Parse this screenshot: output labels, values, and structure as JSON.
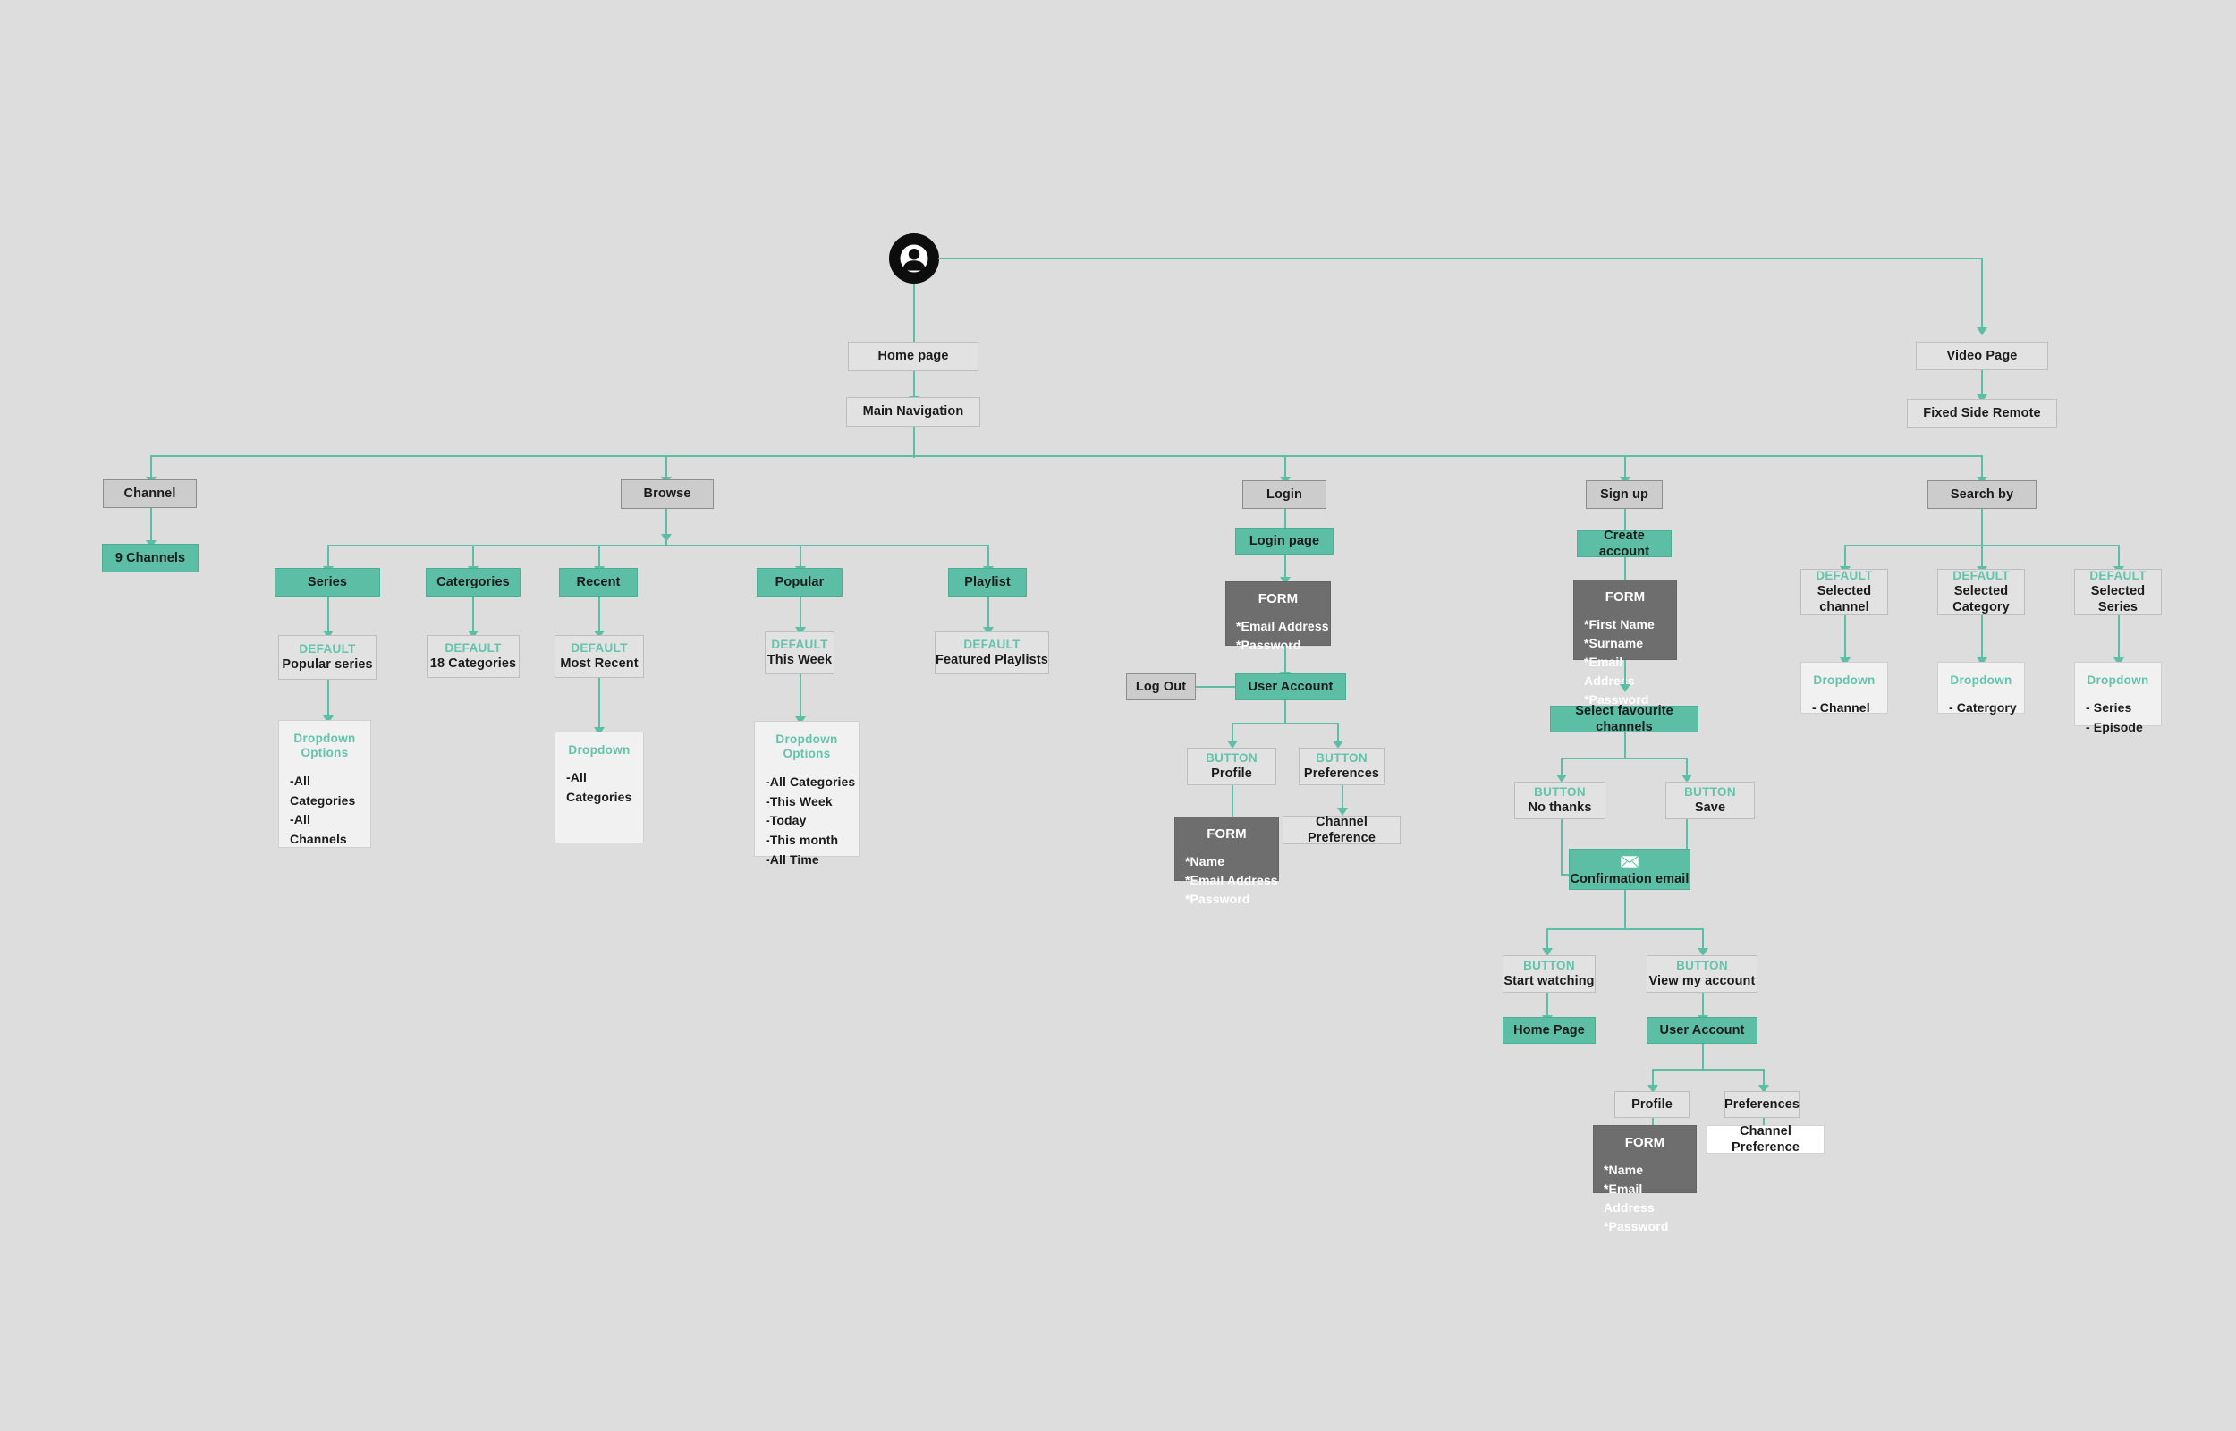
{
  "colors": {
    "background": "#dddddd",
    "accent_teal": "#5cbfa5",
    "page_box": "#cccccc",
    "form_box": "#6e6e6e",
    "dropdown_panel": "#f1f1f1",
    "kicker_text": "#63c4ab"
  },
  "root": {
    "avatar_icon": "user-avatar-icon"
  },
  "labels": {
    "kicker_default": "DEFAULT",
    "kicker_button": "BUTTON",
    "kicker_dropdown": "Dropdown",
    "kicker_dropdown_options_l1": "Dropdown",
    "kicker_dropdown_options_l2": "Options",
    "form_title": "FORM"
  },
  "home_branch": {
    "home_page": "Home page",
    "main_navigation": "Main Navigation"
  },
  "video_branch": {
    "video_page": "Video Page",
    "fixed_side_remote": "Fixed Side Remote"
  },
  "nav_items": {
    "channel": "Channel",
    "browse": "Browse",
    "login": "Login",
    "signup": "Sign up",
    "search_by": "Search by"
  },
  "channel_branch": {
    "nine_channels": "9 Channels"
  },
  "browse_branch": {
    "series": {
      "title": "Series",
      "default_value": "Popular series",
      "dropdown_title_line1": "Dropdown",
      "dropdown_title_line2": "Options",
      "options": "-All Categories\n-All Channels"
    },
    "categories": {
      "title": "Catergories",
      "default_value": "18 Categories"
    },
    "recent": {
      "title": "Recent",
      "default_value": "Most Recent",
      "dropdown_title": "Dropdown",
      "options": "-All Categories"
    },
    "popular": {
      "title": "Popular",
      "default_value": "This Week",
      "dropdown_title_line1": "Dropdown",
      "dropdown_title_line2": "Options",
      "options": "-All Categories\n-This Week\n-Today\n-This month\n-All Time"
    },
    "playlist": {
      "title": "Playlist",
      "default_value": "Featured Playlists"
    }
  },
  "login_branch": {
    "login_page": "Login page",
    "form_fields": "*Email Address\n*Password",
    "log_out": "Log Out",
    "user_account": "User Account",
    "button_profile": "Profile",
    "button_preferences": "Preferences",
    "profile_form_fields": "*Name\n*Email Address\n*Password",
    "channel_preference": "Channel Preference"
  },
  "signup_branch": {
    "create_account": "Create account",
    "form_fields": "*First Name\n*Surname\n*Email Address\n*Password",
    "select_favourite_channels": "Select favourite channels",
    "button_no_thanks": "No thanks",
    "button_save": "Save",
    "confirmation_email": "Confirmation email",
    "confirmation_email_icon": "envelope-icon",
    "button_start_watching": "Start watching",
    "button_view_my_account": "View my account",
    "home_page": "Home Page",
    "user_account": "User Account",
    "profile": "Profile",
    "preferences": "Preferences",
    "profile_form_fields": "*Name\n*Email Address\n*Password",
    "channel_preference": "Channel Preference"
  },
  "search_branch": {
    "channel": {
      "default_value_line1": "Selected",
      "default_value_line2": "channel",
      "dropdown_title": "Dropdown",
      "options": "- Channel"
    },
    "category": {
      "default_value_line1": "Selected",
      "default_value_line2": "Category",
      "dropdown_title": "Dropdown",
      "options": "- Catergory"
    },
    "series": {
      "default_value_line1": "Selected",
      "default_value_line2": "Series",
      "dropdown_title": "Dropdown",
      "options": "- Series\n- Episode"
    }
  }
}
